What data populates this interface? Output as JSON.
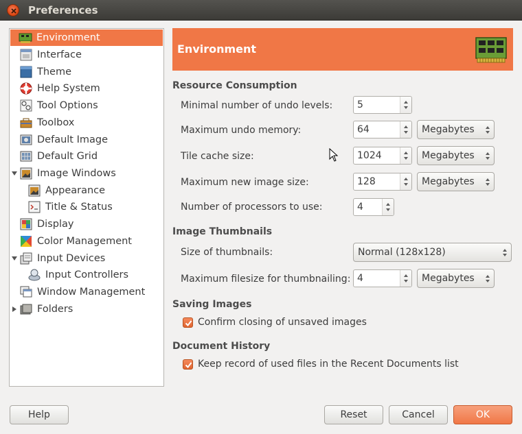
{
  "window": {
    "title": "Preferences"
  },
  "sidebar": {
    "items": [
      {
        "label": "Environment",
        "icon": "environment-icon",
        "selected": true
      },
      {
        "label": "Interface",
        "icon": "interface-icon"
      },
      {
        "label": "Theme",
        "icon": "theme-icon"
      },
      {
        "label": "Help System",
        "icon": "help-system-icon"
      },
      {
        "label": "Tool Options",
        "icon": "tool-options-icon"
      },
      {
        "label": "Toolbox",
        "icon": "toolbox-icon"
      },
      {
        "label": "Default Image",
        "icon": "default-image-icon"
      },
      {
        "label": "Default Grid",
        "icon": "default-grid-icon"
      },
      {
        "label": "Image Windows",
        "icon": "image-windows-icon",
        "expanded": true
      },
      {
        "label": "Appearance",
        "icon": "appearance-icon"
      },
      {
        "label": "Title & Status",
        "icon": "title-status-icon"
      },
      {
        "label": "Display",
        "icon": "display-icon"
      },
      {
        "label": "Color Management",
        "icon": "color-management-icon"
      },
      {
        "label": "Input Devices",
        "icon": "input-devices-icon",
        "expanded": true
      },
      {
        "label": "Input Controllers",
        "icon": "input-controllers-icon"
      },
      {
        "label": "Window Management",
        "icon": "window-management-icon"
      },
      {
        "label": "Folders",
        "icon": "folders-icon",
        "expanded": false
      }
    ]
  },
  "main": {
    "banner_title": "Environment",
    "resource": {
      "title": "Resource Consumption",
      "undo_levels_label": "Minimal number of undo levels:",
      "undo_levels_value": "5",
      "undo_memory_label": "Maximum undo memory:",
      "undo_memory_value": "64",
      "undo_memory_unit": "Megabytes",
      "tile_cache_label": "Tile cache size:",
      "tile_cache_value": "1024",
      "tile_cache_unit": "Megabytes",
      "max_image_label": "Maximum new image size:",
      "max_image_value": "128",
      "max_image_unit": "Megabytes",
      "processors_label": "Number of processors to use:",
      "processors_value": "4"
    },
    "thumbnails": {
      "title": "Image Thumbnails",
      "size_label": "Size of thumbnails:",
      "size_value": "Normal (128x128)",
      "filesize_label": "Maximum filesize for thumbnailing:",
      "filesize_value": "4",
      "filesize_unit": "Megabytes"
    },
    "saving": {
      "title": "Saving Images",
      "confirm_label": "Confirm closing of unsaved images",
      "confirm_checked": true
    },
    "history": {
      "title": "Document History",
      "keep_label": "Keep record of used files in the Recent Documents list",
      "keep_checked": true
    }
  },
  "buttons": {
    "help": "Help",
    "reset": "Reset",
    "cancel": "Cancel",
    "ok": "OK"
  },
  "colors": {
    "accent": "#f07746",
    "titlebar": "#3c3b37",
    "background": "#f2f1f0"
  }
}
